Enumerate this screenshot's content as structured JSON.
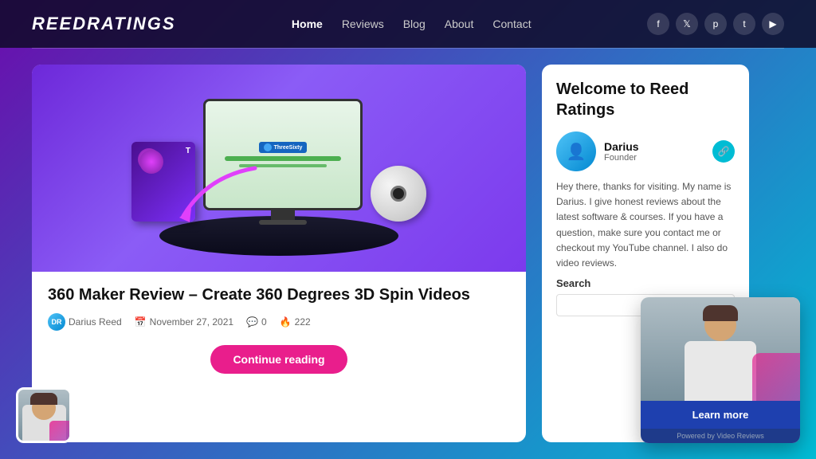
{
  "header": {
    "logo": "ReedRatings",
    "nav": {
      "items": [
        {
          "label": "Home",
          "active": true
        },
        {
          "label": "Reviews",
          "active": false
        },
        {
          "label": "Blog",
          "active": false
        },
        {
          "label": "About",
          "active": false
        },
        {
          "label": "Contact",
          "active": false
        }
      ]
    },
    "social": [
      "f",
      "t",
      "p",
      "t",
      "yt"
    ]
  },
  "article": {
    "title": "360 Maker Review – Create 360 Degrees 3D Spin Videos",
    "author": "Darius Reed",
    "date": "November 27, 2021",
    "comments": "0",
    "views": "222",
    "continue_reading": "Continue reading"
  },
  "sidebar": {
    "welcome_title": "Welcome to Reed Ratings",
    "author_name": "Darius",
    "author_role": "Founder",
    "description": "Hey there, thanks for visiting. My name is Darius. I give honest reviews about the latest software & courses. If you have a question, make sure you contact me or checkout my YouTube channel. I also do video reviews.",
    "search_label": "Search",
    "search_placeholder": ""
  },
  "video_overlay": {
    "learn_more": "Learn more",
    "powered_by": "Powered by Video Reviews"
  },
  "icons": {
    "facebook": "f",
    "twitter": "t",
    "pinterest": "p",
    "tumblr": "t",
    "youtube": "▶",
    "comment": "💬",
    "fire": "🔥",
    "calendar": "📅",
    "link": "🔗"
  }
}
